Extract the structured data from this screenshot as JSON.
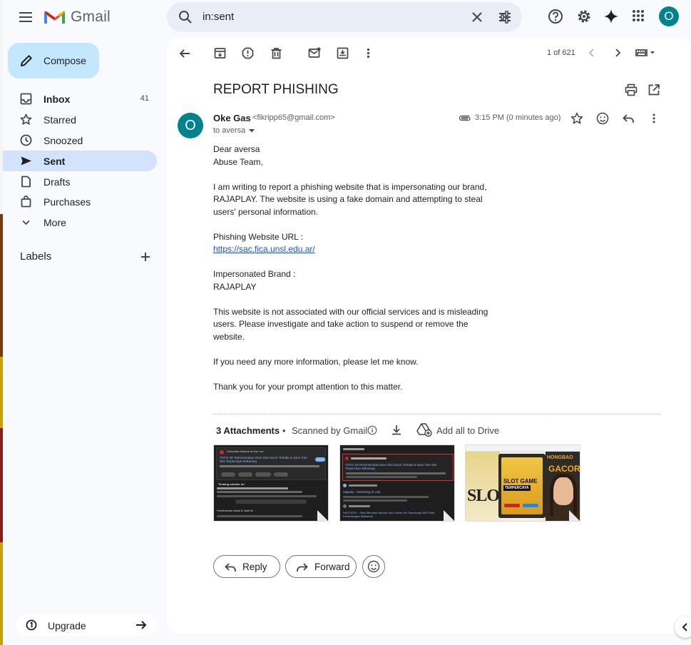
{
  "app": {
    "name": "Gmail",
    "account_initial": "O"
  },
  "search": {
    "value": "in:sent"
  },
  "compose": {
    "label": "Compose"
  },
  "sidebar": {
    "items": [
      {
        "label": "Inbox",
        "count": "41"
      },
      {
        "label": "Starred"
      },
      {
        "label": "Snoozed"
      },
      {
        "label": "Sent"
      },
      {
        "label": "Drafts"
      },
      {
        "label": "Purchases"
      },
      {
        "label": "More"
      }
    ],
    "labels_heading": "Labels",
    "upgrade_label": "Upgrade"
  },
  "toolbar": {
    "pager": "1 of 621"
  },
  "message": {
    "subject": "REPORT PHISHING",
    "sender_initial": "O",
    "sender_name": "Oke Gas",
    "sender_email": "<fikripp65@gmail.com>",
    "to": "to aversa",
    "time": "3:15 PM (0 minutes ago)",
    "body": {
      "greeting_1": "Dear aversa",
      "greeting_2": "Abuse Team,",
      "para_1": "I am writing to report a phishing website that is impersonating our brand, RAJAPLAY. The website is using a fake domain and attempting to steal users' personal information.",
      "url_label": "Phishing Website URL :",
      "url": "https://sac.fica.unsl.edu.ar/",
      "brand_label": "Impersonated Brand :",
      "brand": "RAJAPLAY",
      "para_2": "This website is not associated with our official services and is misleading users. Please investigate and take action to suspend or remove the website.",
      "para_3": "If you need any more information, please let me know.",
      "para_4": "Thank you for your prompt attention to this matter."
    }
  },
  "attachments": {
    "title": "3 Attachments",
    "separator": "•",
    "scanned": "Scanned by Gmail",
    "add_all": "Add all to Drive",
    "thumb_1": {
      "header": "Universitas Nasional de San Luis",
      "title": "TOTO 4D Rekomendasi Situs Slot Gacor Terbaik & Situs Toto Slot Terpercaya Sekarang",
      "section": "Tentang sumber ini",
      "footer": "Penelusuran Anda & hasil ini"
    },
    "thumb_2": {
      "title": "TOTO 4D Rekomendasi Situs Slot Gacor Terbaik & Situs Toto Slot Terpercaya Sekarang",
      "link": "rajaplay - Marketing di Link",
      "footer": "HKITOGEL : Situs Bermain Bandar Slot Online Siri Terpercaya 500 Pasti Kemenangan Maksimal"
    },
    "thumb_3": {
      "text_1": "SLOT GAME",
      "text_2": "TERPERCAYA",
      "text_3": "SLOT",
      "text_4": "GACOR",
      "text_5": "HONGBAO"
    }
  },
  "actions": {
    "reply": "Reply",
    "forward": "Forward"
  },
  "colors": {
    "accent": "#0b57d0",
    "avatar": "#00838f",
    "compose_bg": "#c2e7ff",
    "active_nav": "#d3e3fd"
  }
}
